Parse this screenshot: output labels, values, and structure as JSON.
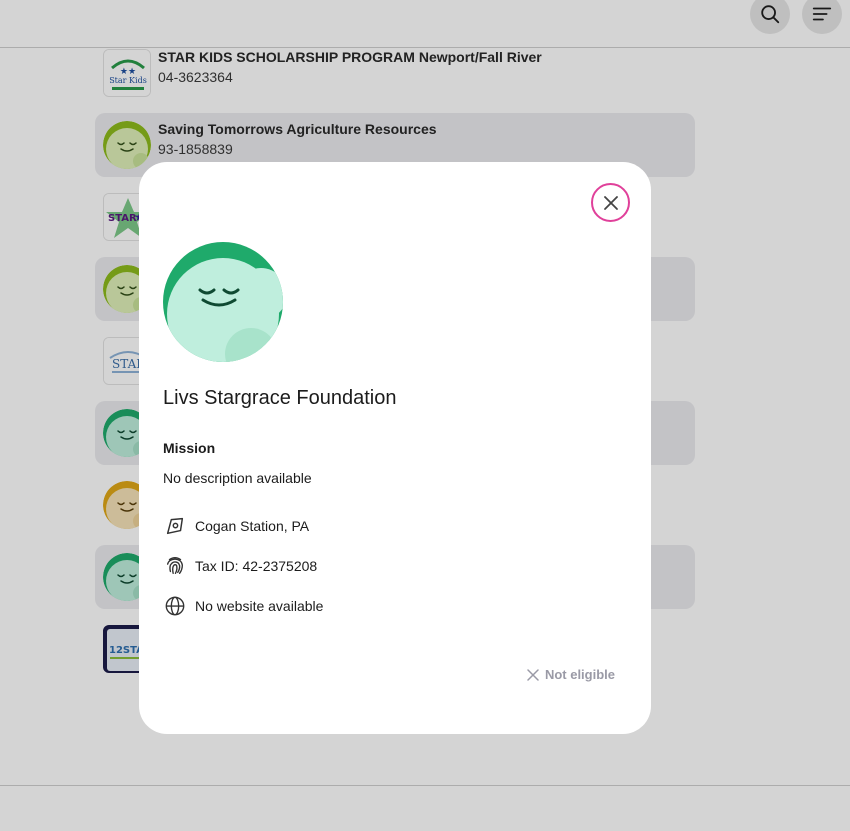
{
  "header": {
    "search_icon": "search-icon",
    "menu_icon": "menu-icon"
  },
  "results": [
    {
      "name": "STAR KIDS SCHOLARSHIP PROGRAM Newport/Fall River",
      "ein": "04-3623364",
      "logo": "star-kids-logo"
    },
    {
      "name": "Saving Tomorrows Agriculture Resources",
      "ein": "93-1858839",
      "logo": "default-avatar-lime"
    },
    {
      "name": "",
      "ein": "",
      "logo": "star-burst-logo"
    },
    {
      "name": "",
      "ein": "",
      "logo": "default-avatar-lime"
    },
    {
      "name": "",
      "ein": "",
      "logo": "star-text-logo"
    },
    {
      "name": "",
      "ein": "",
      "logo": "default-avatar-green"
    },
    {
      "name": "",
      "ein": "",
      "logo": "default-avatar-gold"
    },
    {
      "name": "",
      "ein": "",
      "logo": "default-avatar-green"
    },
    {
      "name": "",
      "ein": "",
      "logo": "12-star-logo"
    }
  ],
  "modal": {
    "title": "Livs Stargrace Foundation",
    "mission_label": "Mission",
    "mission_text": "No description available",
    "location": "Cogan Station, PA",
    "tax_id": "Tax ID: 42-2375208",
    "website": "No website available",
    "status": "Not eligible",
    "close_icon": "close-icon",
    "colors": {
      "avatar_dark": "#1faa6b",
      "avatar_light": "#bfeedd",
      "close_ring": "#e0409a",
      "status": "#9a9aa6"
    }
  }
}
